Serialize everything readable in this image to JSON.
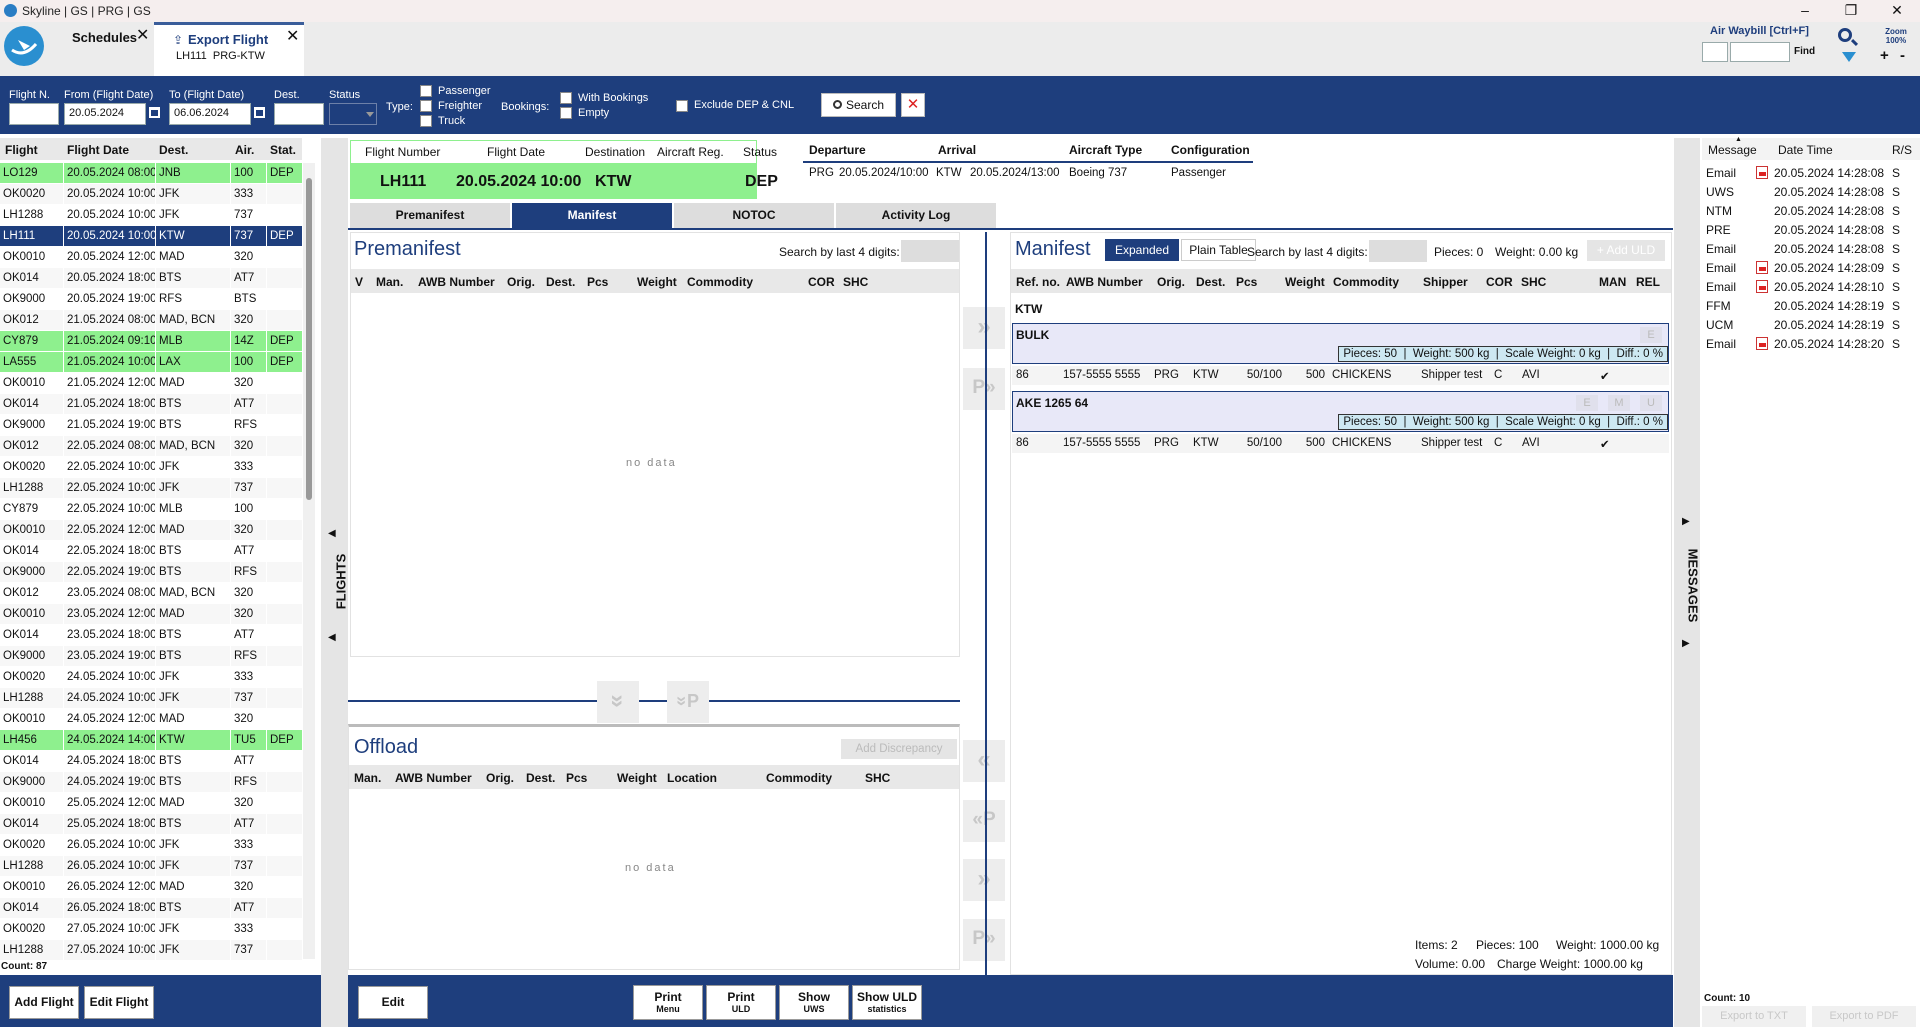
{
  "window": {
    "title": "Skyline | GS | PRG | GS"
  },
  "tabs": [
    {
      "label": "Schedules"
    },
    {
      "label": "Export Flight",
      "sub": "LH111  PRG-KTW"
    }
  ],
  "awb_search": {
    "label": "Air Waybill [Ctrl+F]",
    "find": "Find",
    "zoom": "Zoom 100%"
  },
  "filters": {
    "flight_n": "Flight N.",
    "from_label": "From (Flight Date)",
    "from_value": "20.05.2024",
    "to_label": "To (Flight Date)",
    "to_value": "06.06.2024",
    "dest": "Dest.",
    "status": "Status",
    "type_label": "Type:",
    "types": [
      "Passenger",
      "Freighter",
      "Truck"
    ],
    "bookings_label": "Bookings:",
    "bookings": [
      "With Bookings",
      "Empty"
    ],
    "exclude": "Exclude DEP & CNL",
    "search": "Search"
  },
  "flights": {
    "headers": [
      "Flight",
      "Flight Date",
      "Dest.",
      "Air.",
      "Stat."
    ],
    "count": "Count: 87",
    "side_label": "FLIGHTS",
    "rows": [
      {
        "f": "LO129",
        "d": "20.05.2024 08:00",
        "dest": "JNB",
        "a": "100",
        "s": "DEP",
        "hl": "green"
      },
      {
        "f": "OK0020",
        "d": "20.05.2024 10:00",
        "dest": "JFK",
        "a": "333",
        "s": "",
        "hl": ""
      },
      {
        "f": "LH1288",
        "d": "20.05.2024 10:00",
        "dest": "JFK",
        "a": "737",
        "s": "",
        "hl": ""
      },
      {
        "f": "LH111",
        "d": "20.05.2024 10:00",
        "dest": "KTW",
        "a": "737",
        "s": "DEP",
        "hl": "sel"
      },
      {
        "f": "OK0010",
        "d": "20.05.2024 12:00",
        "dest": "MAD",
        "a": "320",
        "s": "",
        "hl": ""
      },
      {
        "f": "OK014",
        "d": "20.05.2024 18:00",
        "dest": "BTS",
        "a": "AT7",
        "s": "",
        "hl": ""
      },
      {
        "f": "OK9000",
        "d": "20.05.2024 19:00",
        "dest": "RFS",
        "a": "BTS",
        "s": "",
        "hl": ""
      },
      {
        "f": "OK012",
        "d": "21.05.2024 08:00",
        "dest": "MAD, BCN",
        "a": "320",
        "s": "",
        "hl": ""
      },
      {
        "f": "CY879",
        "d": "21.05.2024 09:10",
        "dest": "MLB",
        "a": "14Z",
        "s": "DEP",
        "hl": "green"
      },
      {
        "f": "LA555",
        "d": "21.05.2024 10:00",
        "dest": "LAX",
        "a": "100",
        "s": "DEP",
        "hl": "green"
      },
      {
        "f": "OK0010",
        "d": "21.05.2024 12:00",
        "dest": "MAD",
        "a": "320",
        "s": "",
        "hl": ""
      },
      {
        "f": "OK014",
        "d": "21.05.2024 18:00",
        "dest": "BTS",
        "a": "AT7",
        "s": "",
        "hl": ""
      },
      {
        "f": "OK9000",
        "d": "21.05.2024 19:00",
        "dest": "BTS",
        "a": "RFS",
        "s": "",
        "hl": ""
      },
      {
        "f": "OK012",
        "d": "22.05.2024 08:00",
        "dest": "MAD, BCN",
        "a": "320",
        "s": "",
        "hl": ""
      },
      {
        "f": "OK0020",
        "d": "22.05.2024 10:00",
        "dest": "JFK",
        "a": "333",
        "s": "",
        "hl": ""
      },
      {
        "f": "LH1288",
        "d": "22.05.2024 10:00",
        "dest": "JFK",
        "a": "737",
        "s": "",
        "hl": ""
      },
      {
        "f": "CY879",
        "d": "22.05.2024 10:00",
        "dest": "MLB",
        "a": "100",
        "s": "",
        "hl": ""
      },
      {
        "f": "OK0010",
        "d": "22.05.2024 12:00",
        "dest": "MAD",
        "a": "320",
        "s": "",
        "hl": ""
      },
      {
        "f": "OK014",
        "d": "22.05.2024 18:00",
        "dest": "BTS",
        "a": "AT7",
        "s": "",
        "hl": ""
      },
      {
        "f": "OK9000",
        "d": "22.05.2024 19:00",
        "dest": "BTS",
        "a": "RFS",
        "s": "",
        "hl": ""
      },
      {
        "f": "OK012",
        "d": "23.05.2024 08:00",
        "dest": "MAD, BCN",
        "a": "320",
        "s": "",
        "hl": ""
      },
      {
        "f": "OK0010",
        "d": "23.05.2024 12:00",
        "dest": "MAD",
        "a": "320",
        "s": "",
        "hl": ""
      },
      {
        "f": "OK014",
        "d": "23.05.2024 18:00",
        "dest": "BTS",
        "a": "AT7",
        "s": "",
        "hl": ""
      },
      {
        "f": "OK9000",
        "d": "23.05.2024 19:00",
        "dest": "BTS",
        "a": "RFS",
        "s": "",
        "hl": ""
      },
      {
        "f": "OK0020",
        "d": "24.05.2024 10:00",
        "dest": "JFK",
        "a": "333",
        "s": "",
        "hl": ""
      },
      {
        "f": "LH1288",
        "d": "24.05.2024 10:00",
        "dest": "JFK",
        "a": "737",
        "s": "",
        "hl": ""
      },
      {
        "f": "OK0010",
        "d": "24.05.2024 12:00",
        "dest": "MAD",
        "a": "320",
        "s": "",
        "hl": ""
      },
      {
        "f": "LH456",
        "d": "24.05.2024 14:00",
        "dest": "KTW",
        "a": "TU5",
        "s": "DEP",
        "hl": "green"
      },
      {
        "f": "OK014",
        "d": "24.05.2024 18:00",
        "dest": "BTS",
        "a": "AT7",
        "s": "",
        "hl": ""
      },
      {
        "f": "OK9000",
        "d": "24.05.2024 19:00",
        "dest": "BTS",
        "a": "RFS",
        "s": "",
        "hl": ""
      },
      {
        "f": "OK0010",
        "d": "25.05.2024 12:00",
        "dest": "MAD",
        "a": "320",
        "s": "",
        "hl": ""
      },
      {
        "f": "OK014",
        "d": "25.05.2024 18:00",
        "dest": "BTS",
        "a": "AT7",
        "s": "",
        "hl": ""
      },
      {
        "f": "OK0020",
        "d": "26.05.2024 10:00",
        "dest": "JFK",
        "a": "333",
        "s": "",
        "hl": ""
      },
      {
        "f": "LH1288",
        "d": "26.05.2024 10:00",
        "dest": "JFK",
        "a": "737",
        "s": "",
        "hl": ""
      },
      {
        "f": "OK0010",
        "d": "26.05.2024 12:00",
        "dest": "MAD",
        "a": "320",
        "s": "",
        "hl": ""
      },
      {
        "f": "OK014",
        "d": "26.05.2024 18:00",
        "dest": "BTS",
        "a": "AT7",
        "s": "",
        "hl": ""
      },
      {
        "f": "OK0020",
        "d": "27.05.2024 10:00",
        "dest": "JFK",
        "a": "333",
        "s": "",
        "hl": ""
      },
      {
        "f": "LH1288",
        "d": "27.05.2024 10:00",
        "dest": "JFK",
        "a": "737",
        "s": "",
        "hl": ""
      }
    ]
  },
  "flight_info": {
    "headers": [
      "Flight Number",
      "Flight Date",
      "Destination",
      "Aircraft Reg.",
      "Status"
    ],
    "number": "LH111",
    "date": "20.05.2024 10:00",
    "destination": "KTW",
    "status": "DEP",
    "route_headers": [
      "Departure",
      "Arrival",
      "Aircraft Type",
      "Configuration"
    ],
    "route": [
      "PRG",
      "20.05.2024/10:00",
      "KTW",
      "20.05.2024/13:00",
      "Boeing 737",
      "Passenger"
    ]
  },
  "view_tabs": [
    "Premanifest",
    "Manifest",
    "NOTOC",
    "Activity Log"
  ],
  "premanifest": {
    "title": "Premanifest",
    "search_label": "Search by last 4 digits:",
    "headers": [
      "V",
      "Man.",
      "AWB Number",
      "Orig.",
      "Dest.",
      "Pcs",
      "Weight",
      "Commodity",
      "COR",
      "SHC"
    ],
    "empty": "no data"
  },
  "offload": {
    "title": "Offload",
    "add_discrepancy": "Add Discrepancy",
    "headers": [
      "Man.",
      "AWB Number",
      "Orig.",
      "Dest.",
      "Pcs",
      "Weight",
      "Location",
      "Commodity",
      "SHC"
    ],
    "empty": "no data"
  },
  "transfer_buttons": {
    "right": "»",
    "right_p": "P»",
    "left": "«",
    "left_p": "«P",
    "down": "»",
    "down_p": "»P"
  },
  "manifest": {
    "title": "Manifest",
    "view_expanded": "Expanded",
    "view_plain": "Plain Table",
    "search_label": "Search by last 4 digits:",
    "pieces": "Pieces: 0",
    "weight": "Weight: 0.00 kg",
    "add_uld": "+ Add ULD",
    "headers": [
      "Ref. no.",
      "AWB Number",
      "Orig.",
      "Dest.",
      "Pcs",
      "Weight",
      "Commodity",
      "Shipper",
      "COR",
      "SHC",
      "MAN",
      "REL"
    ],
    "dest_group": "KTW",
    "ulds": [
      {
        "name": "BULK",
        "info": "Pieces: 50  |  Weight: 500 kg  |  Scale Weight: 0 kg  |  Diff.: 0 %",
        "flags": [
          "E"
        ],
        "row": {
          "ref": "86",
          "awb": "157-5555 5555",
          "orig": "PRG",
          "dest": "KTW",
          "pcs": "50/100",
          "weight": "500",
          "commodity": "CHICKENS",
          "shipper": "Shipper test",
          "cor": "C",
          "shc": "AVI",
          "man": "✔"
        }
      },
      {
        "name": "AKE 1265 64",
        "info": "Pieces: 50  |  Weight: 500 kg  |  Scale Weight: 0 kg  |  Diff.: 0 %",
        "flags": [
          "E",
          "M",
          "U"
        ],
        "row": {
          "ref": "86",
          "awb": "157-5555 5555",
          "orig": "PRG",
          "dest": "KTW",
          "pcs": "50/100",
          "weight": "500",
          "commodity": "CHICKENS",
          "shipper": "Shipper test",
          "cor": "C",
          "shc": "AVI",
          "man": "✔"
        }
      }
    ],
    "totals": {
      "items": "Items: 2",
      "pieces": "Pieces: 100",
      "weight": "Weight: 1000.00 kg",
      "volume": "Volume: 0.00",
      "charge": "Charge Weight: 1000.00 kg"
    }
  },
  "messages": {
    "side_label": "MESSAGES",
    "headers": [
      "Message",
      "Date Time",
      "R/S"
    ],
    "rows": [
      {
        "m": "Email",
        "pdf": true,
        "t": "20.05.2024 14:28:08",
        "rs": "S"
      },
      {
        "m": "UWS",
        "pdf": false,
        "t": "20.05.2024 14:28:08",
        "rs": "S"
      },
      {
        "m": "NTM",
        "pdf": false,
        "t": "20.05.2024 14:28:08",
        "rs": "S"
      },
      {
        "m": "PRE",
        "pdf": false,
        "t": "20.05.2024 14:28:08",
        "rs": "S"
      },
      {
        "m": "Email",
        "pdf": false,
        "t": "20.05.2024 14:28:08",
        "rs": "S"
      },
      {
        "m": "Email",
        "pdf": true,
        "t": "20.05.2024 14:28:09",
        "rs": "S"
      },
      {
        "m": "Email",
        "pdf": true,
        "t": "20.05.2024 14:28:10",
        "rs": "S"
      },
      {
        "m": "FFM",
        "pdf": false,
        "t": "20.05.2024 14:28:19",
        "rs": "S"
      },
      {
        "m": "UCM",
        "pdf": false,
        "t": "20.05.2024 14:28:19",
        "rs": "S"
      },
      {
        "m": "Email",
        "pdf": true,
        "t": "20.05.2024 14:28:20",
        "rs": "S"
      }
    ],
    "count": "Count: 10",
    "export_txt": "Export to TXT",
    "export_pdf": "Export to PDF"
  },
  "footer": {
    "add_flight": "Add Flight",
    "edit_flight": "Edit Flight",
    "edit": "Edit",
    "print_menu": [
      "Print",
      "Menu"
    ],
    "print_uld": [
      "Print",
      "ULD"
    ],
    "show_uws": [
      "Show",
      "UWS"
    ],
    "show_uld": [
      "Show ULD",
      "statistics"
    ]
  },
  "colors": {
    "navy": "#1e3e7d",
    "green_row": "#8ef08e",
    "selected": "#1e3e7d",
    "uld_bg": "#e8e8f8",
    "uld_info": "#cde8f2"
  }
}
